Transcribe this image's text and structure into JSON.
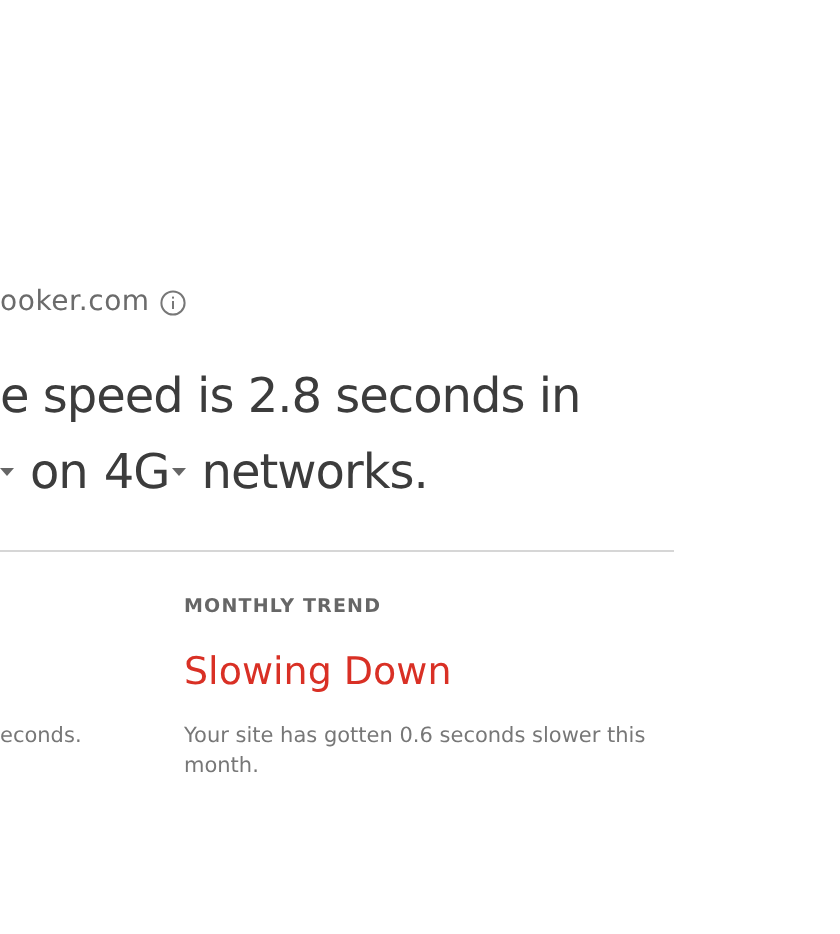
{
  "site": {
    "domain": "ooker.com"
  },
  "headline": {
    "line_1": "e speed is 2.8 seconds in",
    "line_2": [
      {
        "kind": "caret"
      },
      {
        "kind": "text",
        "text": "on"
      },
      {
        "kind": "dropdown",
        "text": "4G"
      },
      {
        "kind": "text",
        "text": "networks."
      }
    ]
  },
  "left_column": {
    "description": "econds."
  },
  "monthly_trend": {
    "label": "MONTHLY TREND",
    "slower": true,
    "value": "Slowing Down",
    "description": "Your site has gotten 0.6 seconds slower this month."
  }
}
